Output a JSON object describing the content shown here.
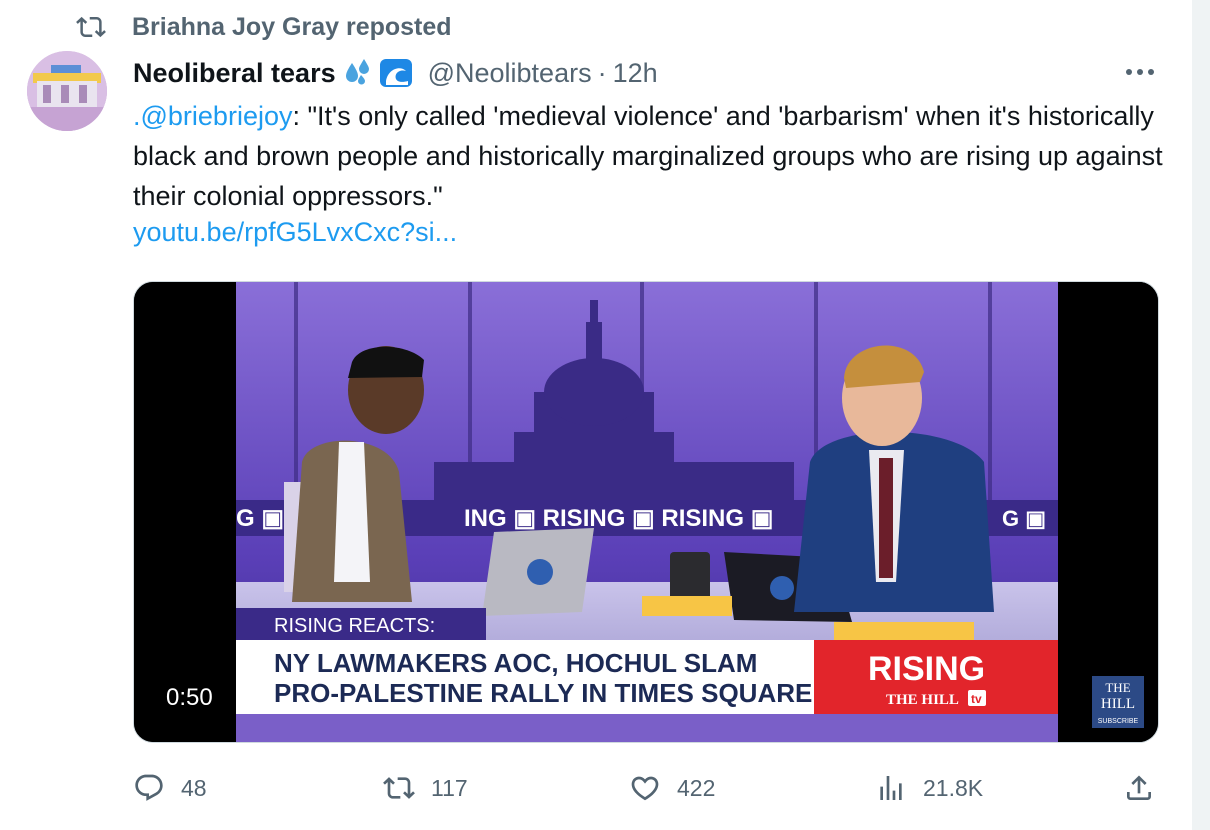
{
  "repost": {
    "icon": "repost-icon",
    "text": "Briahna Joy Gray reposted"
  },
  "author": {
    "name": "Neoliberal tears",
    "emoji": "💦🌊",
    "handle": "@Neolibtears",
    "separator": "·",
    "time": "12h"
  },
  "tweet": {
    "mention": ".@briebriejoy",
    "body": ": \"It's only called 'medieval violence' and 'barbarism' when it's historically black and brown people and historically marginalized groups who are rising up against their colonial oppressors.\"",
    "link": "youtu.be/rpfG5LvxCxc?si..."
  },
  "video": {
    "duration": "0:50",
    "lower_third_label": "RISING REACTS:",
    "headline_line1": "NY LAWMAKERS AOC, HOCHUL SLAM",
    "headline_line2": "PRO-PALESTINE RALLY IN TIMES SQUARE",
    "brand": "RISING",
    "brand_sub": "THE HILL",
    "brand_tv": "tv",
    "backdrop_text": "ING  ▣ RISING  ▣ RISING ▣",
    "corner_logo_line1": "THE",
    "corner_logo_line2": "HILL",
    "corner_logo_line3": "SUBSCRIBE"
  },
  "actions": {
    "replies": "48",
    "reposts": "117",
    "likes": "422",
    "views": "21.8K"
  },
  "colors": {
    "link": "#1d9bf0",
    "muted": "#536471",
    "text": "#0f1419",
    "rising_red": "#e2252b"
  }
}
